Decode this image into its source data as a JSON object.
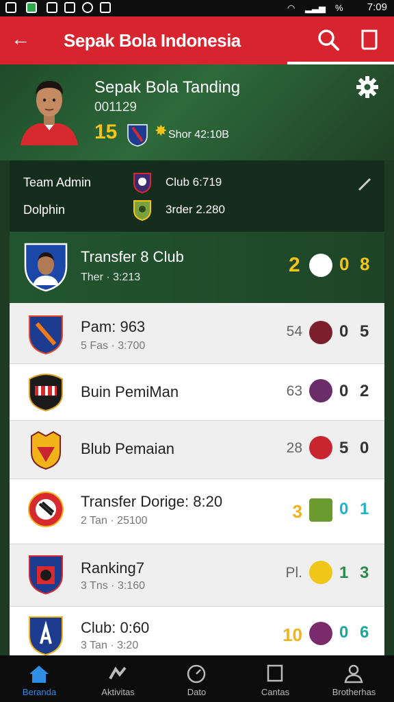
{
  "status_bar": {
    "time": "7:09",
    "battery_pct_label": "%"
  },
  "app_bar": {
    "title": "Sepak Bola Indonesia",
    "back_icon": "arrow-left-icon",
    "search_icon": "search-icon",
    "bookmark_icon": "bookmark-icon"
  },
  "profile": {
    "name": "Sepak Bola Tanding",
    "code": "001129",
    "number": "15",
    "meta": "Shor 42:10B"
  },
  "info": {
    "row1_label": "Team Admin",
    "row1_value": "Club 6:719",
    "row2_label": "Dolphin",
    "row2_value": "3rder 2.280"
  },
  "featured": {
    "title": "Transfer 8 Club",
    "subtitle": "Ther · 3:213",
    "s1": "2",
    "s2": "0",
    "s3": "8"
  },
  "rows": [
    {
      "title": "Pam: 963",
      "subtitle": "5 Fas · 3:700",
      "rank": "54",
      "s1": "0",
      "s2": "5",
      "mini_color": "#7a1f2b",
      "score_color": "#333333"
    },
    {
      "title": "Buin PemiMan",
      "subtitle": "",
      "rank": "63",
      "s1": "0",
      "s2": "2",
      "mini_color": "#6a2d6a",
      "score_color": "#333333"
    },
    {
      "title": "Blub Pemaian",
      "subtitle": "",
      "rank": "28",
      "s1": "5",
      "s2": "0",
      "mini_color": "#c92530",
      "score_color": "#333333"
    },
    {
      "title": "Transfer Dorige: 8:20",
      "subtitle": "2 Tan · 25100",
      "rank": "3",
      "s1": "0",
      "s2": "1",
      "mini_color": "#6b9a2f",
      "score_color": "#20b3c9"
    },
    {
      "title": "Ranking7",
      "subtitle": "3 Tns · 3:160",
      "rank": "Pl.",
      "s1": "1",
      "s2": "3",
      "mini_color": "#f0c619",
      "score_color": "#2a8c4a"
    },
    {
      "title": "Club: 0:60",
      "subtitle": "3 Tan · 3:20",
      "rank": "10",
      "s1": "0",
      "s2": "6",
      "mini_color": "#7b2b6b",
      "score_color": "#1aa79a"
    }
  ],
  "nav": [
    {
      "label": "Beranda",
      "icon": "home-icon",
      "active": true
    },
    {
      "label": "Aktivitas",
      "icon": "activity-icon",
      "active": false
    },
    {
      "label": "Dato",
      "icon": "clock-icon",
      "active": false
    },
    {
      "label": "Cantas",
      "icon": "square-icon",
      "active": false
    },
    {
      "label": "Brotherhas",
      "icon": "user-icon",
      "active": false
    }
  ],
  "colors": {
    "brand_red": "#d7242f",
    "accent_yellow": "#f4c41c",
    "dark_green": "#1f4a2a"
  }
}
